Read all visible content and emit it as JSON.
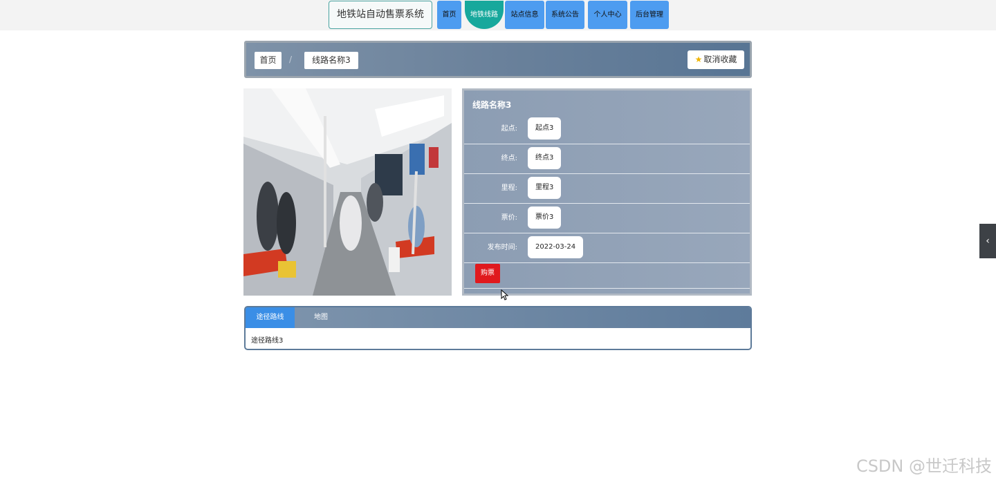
{
  "header": {
    "brand": "地铁站自动售票系统",
    "nav": [
      {
        "label": "首页"
      },
      {
        "label": "地铁线路",
        "active": true
      },
      {
        "label": "站点信息"
      },
      {
        "label": "系统公告"
      },
      {
        "label": "个人中心"
      },
      {
        "label": "后台管理"
      }
    ]
  },
  "breadcrumb": {
    "home": "首页",
    "separator": "/",
    "current": "线路名称3",
    "favorite_label": "取消收藏",
    "favorite_icon": "star-icon"
  },
  "detail": {
    "title": "线路名称3",
    "fields": [
      {
        "label": "起点:",
        "value": "起点3"
      },
      {
        "label": "终点:",
        "value": "终点3"
      },
      {
        "label": "里程:",
        "value": "里程3"
      },
      {
        "label": "票价:",
        "value": "票价3"
      },
      {
        "label": "发布时间:",
        "value": "2022-03-24"
      }
    ],
    "buy_label": "购票"
  },
  "tabs": {
    "items": [
      {
        "label": "途径路线",
        "active": true
      },
      {
        "label": "地图"
      }
    ],
    "content": "途径路线3"
  },
  "side_toggle_icon": "chevron-left-icon",
  "watermark": "CSDN @世迁科技",
  "colors": {
    "nav_button": "#4d9cf0",
    "nav_active": "#17a89c",
    "buy_button": "#e0191e",
    "tab_active": "#3a8ee6"
  }
}
